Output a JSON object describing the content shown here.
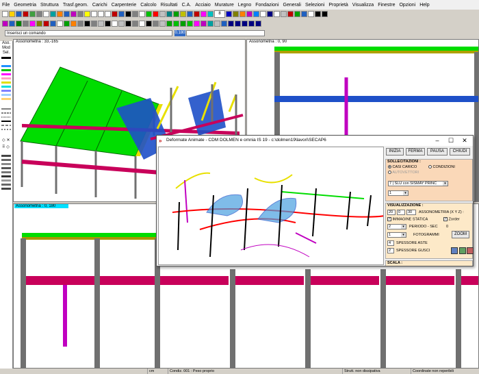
{
  "menu": [
    "File",
    "Geometria",
    "Struttura",
    "Trasf.geom.",
    "Carichi",
    "Carpenterie",
    "Calcolo",
    "Risultati",
    "C.A.",
    "Acciaio",
    "Murature",
    "Legno",
    "Fondazioni",
    "Generali",
    "Selezioni",
    "Proprietà",
    "Visualizza",
    "Finestre",
    "Opzioni",
    "Help"
  ],
  "toolbar": {
    "layer_value": "8"
  },
  "command": {
    "placeholder": "Inserisci un comando",
    "value": "0.180"
  },
  "left_tools": {
    "labels": [
      "Aso.",
      "Mod",
      "Sel."
    ]
  },
  "views": {
    "top_left": "Assonometria : 33,-165",
    "top_right": "Assonometria : 0, 90",
    "bottom": "Assonometria : 0, 180"
  },
  "dialog": {
    "title": "Deformate Animate - CDM DOLMEN e omnia IS 19 - c:\\dolmen19\\lavori\\SECAP6",
    "buttons": {
      "start": "INIZIA",
      "stop": "FERMA",
      "pause": "PAUSA",
      "close": "CHIUDI"
    },
    "sollecitazioni": {
      "title": "SOLLECITAZIONI :",
      "opt1": "CASI CARICO",
      "opt2": "CONDIZIONI",
      "opt3": "AUTOVETTORI",
      "combo": "7 | SLU con SISMAY PRINC",
      "combo2": "1"
    },
    "visualizzazione": {
      "title": "VISUALIZZAZIONE :",
      "ax": "20",
      "ay": "0",
      "az": "30",
      "axon_label": "ASSONOMETRIA (X Y Z) :",
      "static_label": "IMMAGINE STATICA",
      "zorder_label": "Zorder",
      "period_value": "2",
      "period_label": "PERIODO - SEC",
      "period_num": "0",
      "frames_value": "1",
      "frames_label": "FOTOGRAMMI",
      "zoom": "ZOOM",
      "beam_value": "4",
      "beam_label": "SPESSORE ASTE",
      "shell_value": "2",
      "shell_label": "SPESSORE GUSCI"
    },
    "scala": {
      "title": "SCALA :"
    }
  },
  "status": {
    "unit": "cm",
    "cond": "Condiz. 001 : Peso proprio",
    "strut": "Strutt. non dissipativa",
    "coords": "Coordinate non reperibili"
  },
  "colors": {
    "roof": "#00d000",
    "beam": "#c8005a",
    "steel": "#1e50c8",
    "column": "#707070",
    "yellow": "#e8e000",
    "magenta": "#c000c0"
  }
}
